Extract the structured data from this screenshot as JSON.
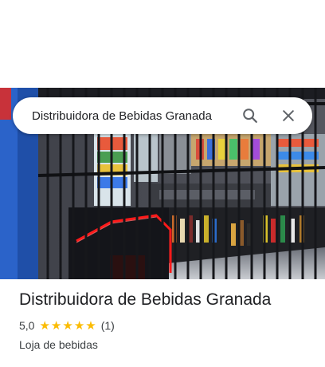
{
  "search": {
    "query": "Distribuidora de Bebidas Granada"
  },
  "place": {
    "name": "Distribuidora de Bebidas Granada",
    "rating": "5,0",
    "stars_filled": 5,
    "review_count": "(1)",
    "category": "Loja de bebidas"
  },
  "icons": {
    "search": "search-icon",
    "close": "close-icon",
    "star": "star-icon"
  },
  "colors": {
    "star": "#fbbc04",
    "icon": "#5f6368",
    "text": "#202124",
    "secondary_text": "#3c4043",
    "neon": "#ff1a1a"
  }
}
